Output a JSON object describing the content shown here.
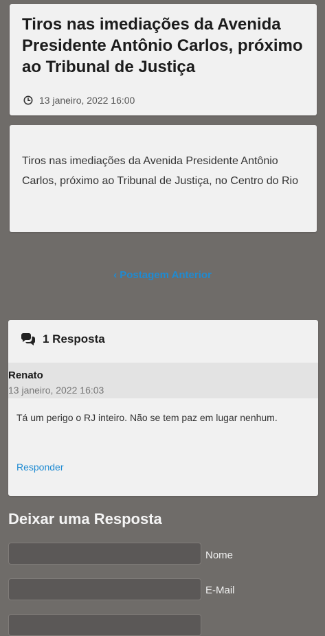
{
  "post": {
    "title": "Tiros nas imediações da Avenida Presidente Antônio Carlos, próximo ao Tribunal de Justiça",
    "date": "13 janeiro, 2022 16:00",
    "body": "Tiros nas imediações da Avenida Presidente Antônio Carlos, próximo ao Tribunal de Justiça, no Centro do Rio"
  },
  "navigation": {
    "previous_label": "Postagem Anterior"
  },
  "comments": {
    "heading": "1 Resposta",
    "items": [
      {
        "author": "Renato",
        "date": "13 janeiro, 2022 16:03",
        "text": "Tá um perigo o RJ inteiro. Não se tem paz em lugar nenhum.",
        "reply_label": "Responder"
      }
    ]
  },
  "reply_form": {
    "heading": "Deixar uma Resposta",
    "name_label": "Nome",
    "email_label": "E-Mail"
  },
  "colors": {
    "background": "#6f6c69",
    "card": "#f1f1f1",
    "link": "#1f8bd2"
  },
  "icons": {
    "date": "clock-icon",
    "comments": "comments-icon",
    "previous": "chevron-left-icon"
  }
}
